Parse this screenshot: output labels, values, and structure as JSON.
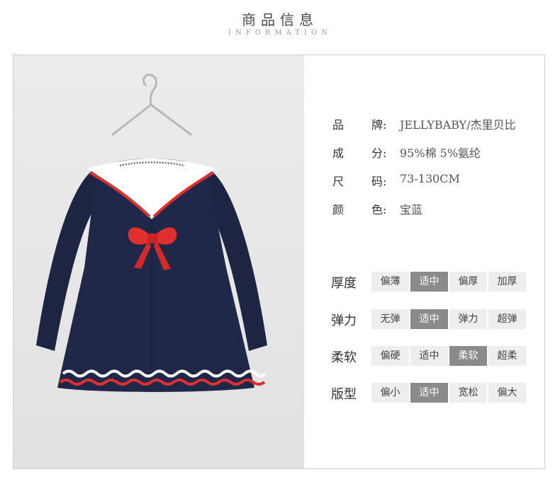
{
  "header": {
    "title": "商品信息",
    "subtitle": "INFORMATION"
  },
  "info": [
    {
      "k1": "品",
      "k2": "牌:",
      "value": "JELLYBABY/杰里贝比"
    },
    {
      "k1": "成",
      "k2": "分:",
      "value": "95%棉 5%氨纶"
    },
    {
      "k1": "尺",
      "k2": "码:",
      "value": "73-130CM"
    },
    {
      "k1": "颜",
      "k2": "色:",
      "value": "宝蓝"
    }
  ],
  "attributes": [
    {
      "label": "厚度",
      "options": [
        "偏薄",
        "适中",
        "偏厚",
        "加厚"
      ],
      "selected": 1
    },
    {
      "label": "弹力",
      "options": [
        "无弹",
        "适中",
        "弹力",
        "超弹"
      ],
      "selected": 1
    },
    {
      "label": "柔软",
      "options": [
        "偏硬",
        "适中",
        "柔软",
        "超柔"
      ],
      "selected": 2
    },
    {
      "label": "版型",
      "options": [
        "偏小",
        "适中",
        "宽松",
        "偏大"
      ],
      "selected": 1
    }
  ],
  "colors": {
    "navy": "#1d2543",
    "red": "#e0302e",
    "white": "#ffffff",
    "selected": "#8b8b8b",
    "unselected": "#eeeeee"
  },
  "photo": {
    "subject": "navy sailor-collar dress with red bow on hanger"
  }
}
